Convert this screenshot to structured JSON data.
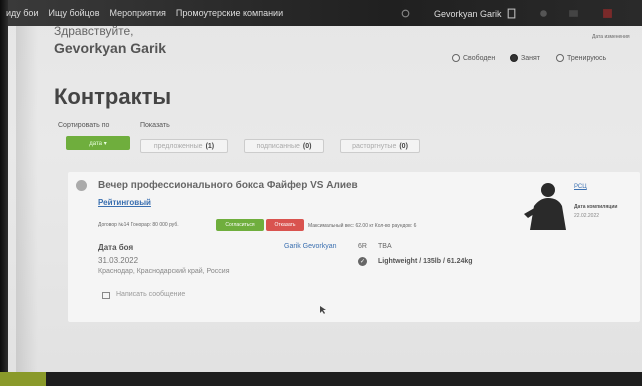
{
  "topbar": {
    "nav": [
      "иду бои",
      "Ищу бойцов",
      "Мероприятия",
      "Промоутерские компании"
    ],
    "user": "Gevorkyan Garik"
  },
  "header": {
    "greeting": "Здравствуйте,",
    "username": "Gevorkyan Garik",
    "top_right_label": "Дата изменения",
    "statuses": [
      {
        "label": "Свободен",
        "selected": false
      },
      {
        "label": "Занят",
        "selected": true
      },
      {
        "label": "Тренируюсь",
        "selected": false
      }
    ]
  },
  "page": {
    "title": "Контракты",
    "sort_label": "Сортировать по",
    "show_label": "Показать",
    "sort_button": "дата ▾",
    "filters": [
      {
        "label": "предложенные",
        "count": "(1)"
      },
      {
        "label": "подписанные",
        "count": "(0)"
      },
      {
        "label": "расторгнутые",
        "count": "(0)"
      }
    ]
  },
  "contract": {
    "event_title": "Вечер профессионального бокса Файфер VS Алиев",
    "rated": "Рейтинговый",
    "contract_text": "Договор №14 Гонорар: 80 000 руб.",
    "agree_button": "Согласиться",
    "refuse_button": "Отказать",
    "contract_tail": "Максимальный вес: 62.00 кг Кол-во раундов: 6",
    "date_heading": "Дата боя",
    "date_value": "31.03.2022",
    "place": "Краснодар, Краснодарский край, Россия",
    "opponent": "Garik Gevorkyan",
    "rounds": "6R",
    "tba": "TBA",
    "weight": "Lightweight / 135lb / 61.24kg",
    "message": "Написать сообщение",
    "side_link": "РСЦ",
    "created_label": "Дата компиляции",
    "created_value": "22.02.2022"
  }
}
